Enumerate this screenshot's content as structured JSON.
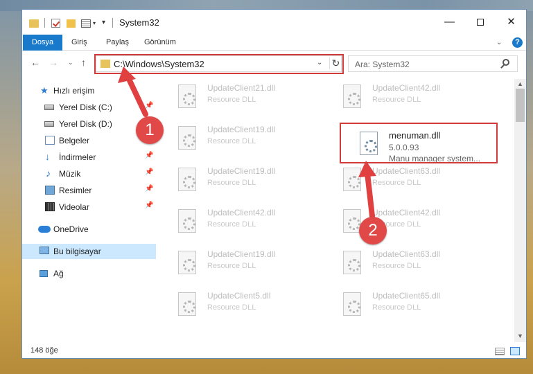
{
  "window": {
    "title": "System32",
    "controls": {
      "minimize": "—",
      "maximize": "",
      "close": "✕"
    }
  },
  "ribbon": {
    "tabs": [
      "Dosya",
      "Giriş",
      "Paylaş",
      "Görünüm"
    ],
    "caret": "⌄",
    "help": "?"
  },
  "navigation": {
    "back": "←",
    "forward": "→",
    "history": "⌄",
    "up": "↑",
    "address": "C:\\Windows\\System32",
    "address_dropdown": "⌄",
    "refresh": "↻",
    "search_placeholder": "Ara: System32"
  },
  "sidebar": {
    "items": [
      {
        "label": "Hızlı erişim",
        "icon": "star-icon",
        "pinned": false
      },
      {
        "label": "Yerel Disk (C:)",
        "icon": "drive-icon",
        "pinned": true
      },
      {
        "label": "Yerel Disk (D:)",
        "icon": "drive-icon",
        "pinned": true
      },
      {
        "label": "Belgeler",
        "icon": "documents-icon",
        "pinned": true
      },
      {
        "label": "İndirmeler",
        "icon": "downloads-icon",
        "pinned": true
      },
      {
        "label": "Müzik",
        "icon": "music-icon",
        "pinned": true
      },
      {
        "label": "Resimler",
        "icon": "pictures-icon",
        "pinned": true
      },
      {
        "label": "Videolar",
        "icon": "videos-icon",
        "pinned": true
      },
      {
        "label": "OneDrive",
        "icon": "onedrive-icon",
        "pinned": false
      },
      {
        "label": "Bu bilgisayar",
        "icon": "computer-icon",
        "pinned": false,
        "selected": true
      },
      {
        "label": "Ağ",
        "icon": "network-icon",
        "pinned": false
      }
    ],
    "pin_glyph": "📌"
  },
  "files": {
    "left": [
      {
        "name": "UpdateClient21.dll",
        "desc": "Resource DLL"
      },
      {
        "name": "UpdateClient19.dll",
        "desc": "Resource DLL"
      },
      {
        "name": "UpdateClient19.dll",
        "desc": "Resource DLL"
      },
      {
        "name": "UpdateClient42.dll",
        "desc": "Resource DLL"
      },
      {
        "name": "UpdateClient19.dll",
        "desc": "Resource DLL"
      },
      {
        "name": "UpdateClient5.dll",
        "desc": "Resource DLL"
      }
    ],
    "right": [
      {
        "name": "UpdateClient42.dll",
        "desc": "Resource DLL"
      },
      {
        "name": "menuman.dll",
        "version": "5.0.0.93",
        "desc": "Manu manager system...",
        "active": true
      },
      {
        "name": "UpdateClient63.dll",
        "desc": "Resource DLL"
      },
      {
        "name": "UpdateClient42.dll",
        "desc": "Resource DLL"
      },
      {
        "name": "UpdateClient63.dll",
        "desc": "Resource DLL"
      },
      {
        "name": "UpdateClient65.dll",
        "desc": "Resource DLL"
      }
    ]
  },
  "status": {
    "count": "148 öğe"
  },
  "callouts": {
    "one": "1",
    "two": "2"
  },
  "colors": {
    "accent": "#1979ca",
    "highlight": "#d33a3a",
    "selection": "#cce8ff"
  }
}
